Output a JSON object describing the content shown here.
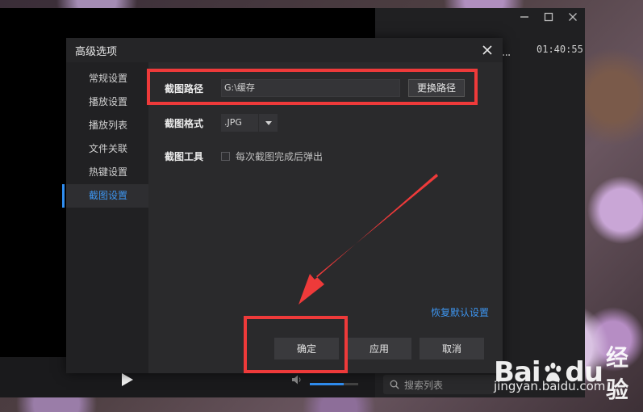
{
  "player": {
    "time": "01:40:55",
    "dots": "...",
    "search_placeholder": "搜索列表",
    "volume_fraction": 0.7
  },
  "dialog": {
    "title": "高级选项",
    "sidebar": {
      "items": [
        {
          "label": "常规设置"
        },
        {
          "label": "播放设置"
        },
        {
          "label": "播放列表"
        },
        {
          "label": "文件关联"
        },
        {
          "label": "热键设置"
        },
        {
          "label": "截图设置",
          "active": true
        }
      ]
    },
    "screenshot_settings": {
      "path_label": "截图路径",
      "path_value": "G:\\缓存",
      "change_path_button": "更换路径",
      "format_label": "截图格式",
      "format_value": ".JPG",
      "tool_label": "截图工具",
      "popup_checkbox_label": "每次截图完成后弹出",
      "popup_checked": false
    },
    "restore_defaults_link": "恢复默认设置",
    "buttons": {
      "ok": "确定",
      "apply": "应用",
      "cancel": "取消"
    }
  },
  "watermark": {
    "brand_left": "Bai",
    "brand_right": "du",
    "brand_cn": "经验",
    "url": "jingyan.baidu.com"
  },
  "colors": {
    "accent": "#2f8df0",
    "annotation": "#ee3a3a",
    "dialog_bg": "#2a2a2c",
    "sidebar_bg": "#212123"
  },
  "icons": [
    "close-icon",
    "minimize-icon",
    "maximize-icon",
    "play-icon",
    "volume-icon",
    "search-icon",
    "dropdown-arrow-icon"
  ]
}
